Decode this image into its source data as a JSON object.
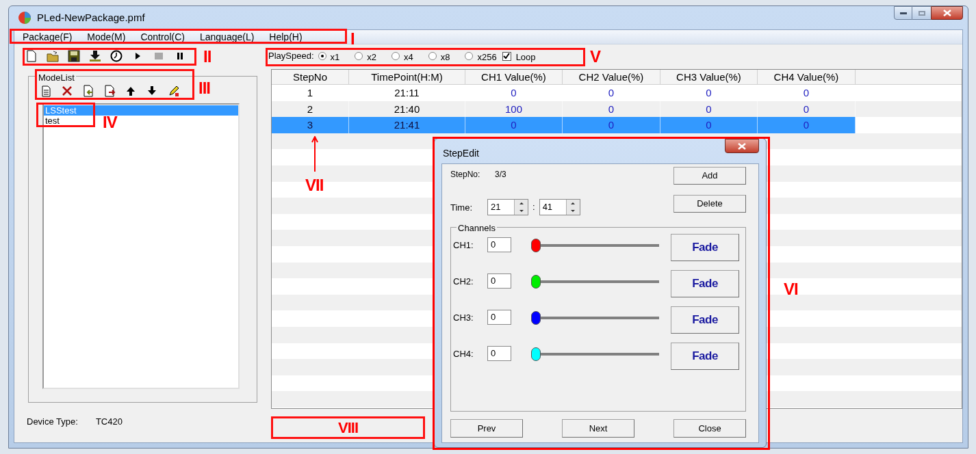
{
  "window": {
    "title": "PLed-NewPackage.pmf"
  },
  "menu": [
    {
      "label": "Package(F)"
    },
    {
      "label": "Mode(M)"
    },
    {
      "label": "Control(C)"
    },
    {
      "label": "Language(L)"
    },
    {
      "label": "Help(H)"
    }
  ],
  "play_speed": {
    "label": "PlaySpeed:",
    "options": [
      {
        "label": "x1",
        "selected": true
      },
      {
        "label": "x2",
        "selected": false
      },
      {
        "label": "x4",
        "selected": false
      },
      {
        "label": "x8",
        "selected": false
      },
      {
        "label": "x256",
        "selected": false
      }
    ],
    "loop": {
      "label": "Loop",
      "checked": true
    }
  },
  "mode_list": {
    "title": "ModeList",
    "items": [
      {
        "label": "LSStest",
        "selected": true
      },
      {
        "label": "test",
        "selected": false
      }
    ]
  },
  "device_type": {
    "label": "Device Type:",
    "value": "TC420"
  },
  "table": {
    "columns": [
      "StepNo",
      "TimePoint(H:M)",
      "CH1 Value(%)",
      "CH2 Value(%)",
      "CH3 Value(%)",
      "CH4 Value(%)"
    ],
    "rows": [
      {
        "cells": [
          "1",
          "21:11",
          "0",
          "0",
          "0",
          "0"
        ],
        "selected": false
      },
      {
        "cells": [
          "2",
          "21:40",
          "100",
          "0",
          "0",
          "0"
        ],
        "selected": false
      },
      {
        "cells": [
          "3",
          "21:41",
          "0",
          "0",
          "0",
          "0"
        ],
        "selected": true
      }
    ]
  },
  "dialog": {
    "title": "StepEdit",
    "step_label": "StepNo:",
    "step_value": "3/3",
    "add_button": "Add",
    "delete_button": "Delete",
    "time_label": "Time:",
    "hour": "21",
    "time_separator": ":",
    "minute": "41",
    "channels_title": "Channels",
    "channels": [
      {
        "label": "CH1:",
        "value": "0",
        "color": "#ff0000",
        "level": 0,
        "button": "Fade"
      },
      {
        "label": "CH2:",
        "value": "0",
        "color": "#00ee00",
        "level": 0,
        "button": "Fade"
      },
      {
        "label": "CH3:",
        "value": "0",
        "color": "#0000ff",
        "level": 0,
        "button": "Fade"
      },
      {
        "label": "CH4:",
        "value": "0",
        "color": "#00ffff",
        "level": 0,
        "button": "Fade"
      }
    ],
    "footer_buttons": [
      "Prev",
      "Next",
      "Close"
    ]
  },
  "annotations": [
    {
      "label": "I"
    },
    {
      "label": "II"
    },
    {
      "label": "III"
    },
    {
      "label": "IV"
    },
    {
      "label": "V"
    },
    {
      "label": "VI"
    },
    {
      "label": "VII"
    },
    {
      "label": "VIII"
    }
  ]
}
